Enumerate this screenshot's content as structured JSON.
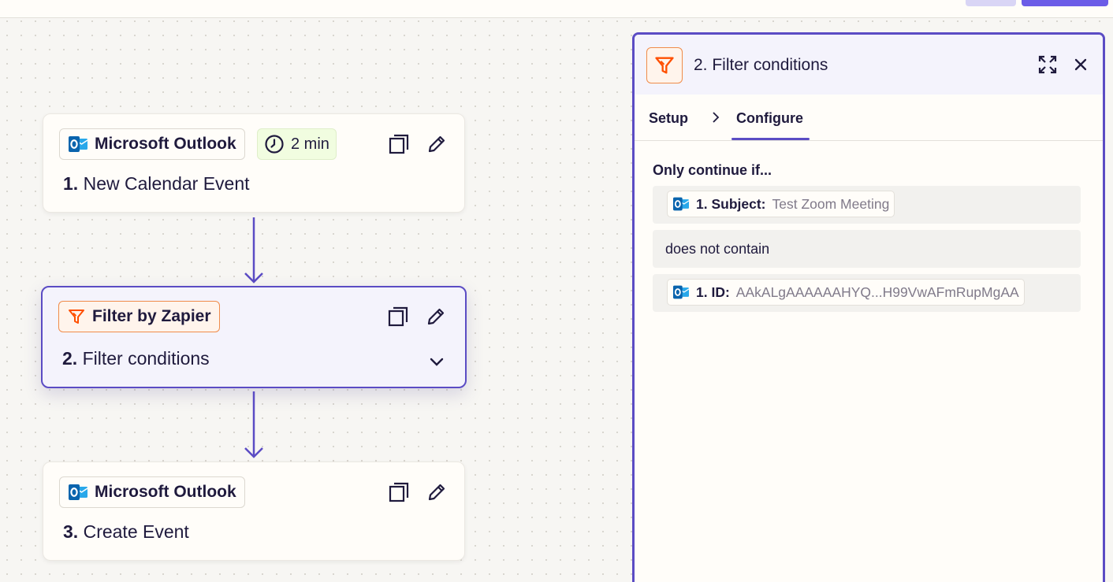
{
  "steps": [
    {
      "app": "Microsoft Outlook",
      "number": "1.",
      "title": "New Calendar Event",
      "badge": "2 min",
      "app_icon": "outlook-icon"
    },
    {
      "app": "Filter by Zapier",
      "number": "2.",
      "title": "Filter conditions",
      "app_icon": "filter-icon"
    },
    {
      "app": "Microsoft Outlook",
      "number": "3.",
      "title": "Create Event",
      "app_icon": "outlook-icon"
    }
  ],
  "panel": {
    "title": "2. Filter conditions",
    "tabs": [
      "Setup",
      "Configure"
    ],
    "active_tab": "Configure",
    "condition_heading": "Only continue if...",
    "field": {
      "label": "1. Subject:",
      "value": "Test Zoom Meeting"
    },
    "operator": "does not contain",
    "compare": {
      "label": "1. ID:",
      "value": "AAkALgAAAAAAHYQ...H99VwAFmRupMgAA"
    }
  },
  "colors": {
    "accent": "#5b4cc4",
    "filter_orange": "#ff4f00",
    "outlook_blue": "#0a64ad",
    "time_badge_bg": "#f1fde0"
  }
}
